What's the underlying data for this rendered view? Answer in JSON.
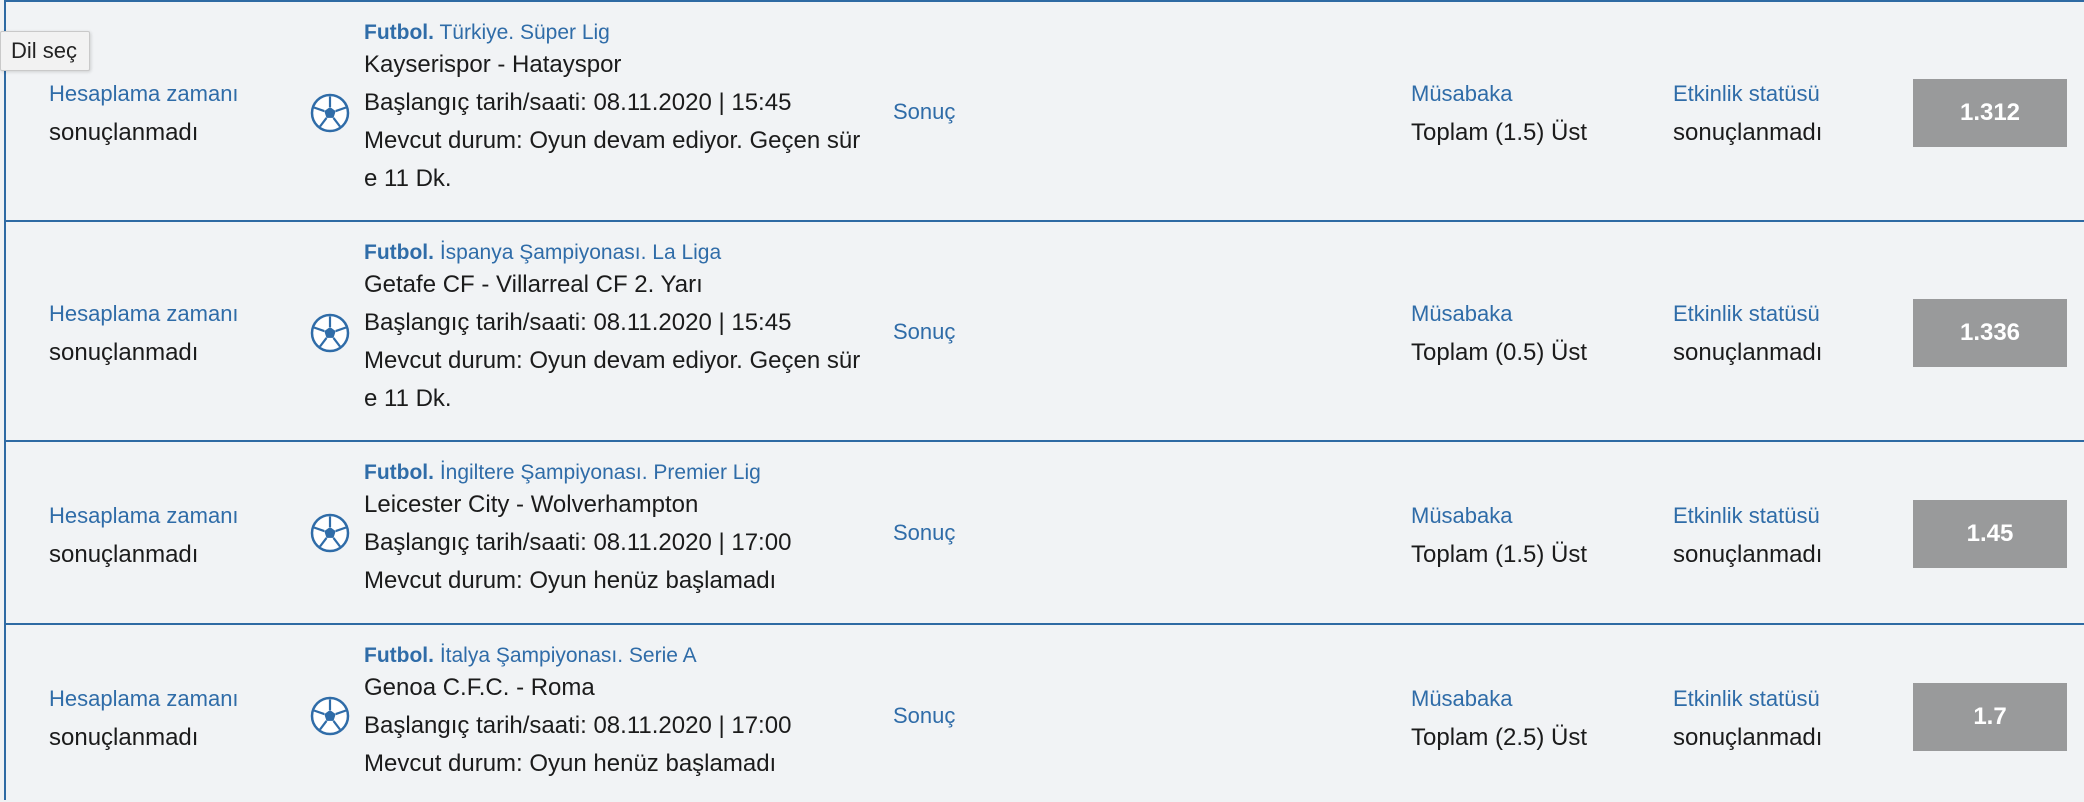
{
  "tooltip": "Dil seç",
  "rows": [
    {
      "calc_label": "Hesaplama zamanı",
      "calc_value": "sonuçlanmadı",
      "sport": "Futbol.",
      "league": " Türkiye. Süper Lig",
      "match": "Kayserispor - Hatayspor",
      "start": "Başlangıç tarih/saati: 08.11.2020 | 15:45",
      "status": "Mevcut durum: Oyun devam ediyor. Geçen süre 11 Dk.",
      "result": "Sonuç",
      "market_label": "Müsabaka",
      "market_value": "Toplam (1.5) Üst",
      "event_status_label": "Etkinlik statüsü",
      "event_status_value": "sonuçlanmadı",
      "odd": "1.312"
    },
    {
      "calc_label": "Hesaplama zamanı",
      "calc_value": "sonuçlanmadı",
      "sport": "Futbol.",
      "league": " İspanya Şampiyonası. La Liga",
      "match": "Getafe CF - Villarreal CF 2. Yarı",
      "start": "Başlangıç tarih/saati: 08.11.2020 | 15:45",
      "status": "Mevcut durum: Oyun devam ediyor. Geçen süre 11 Dk.",
      "result": "Sonuç",
      "market_label": "Müsabaka",
      "market_value": "Toplam (0.5) Üst",
      "event_status_label": "Etkinlik statüsü",
      "event_status_value": "sonuçlanmadı",
      "odd": "1.336"
    },
    {
      "calc_label": "Hesaplama zamanı",
      "calc_value": "sonuçlanmadı",
      "sport": "Futbol.",
      "league": " İngiltere Şampiyonası. Premier Lig",
      "match": "Leicester City - Wolverhampton",
      "start": "Başlangıç tarih/saati: 08.11.2020 | 17:00",
      "status": "Mevcut durum: Oyun henüz başlamadı",
      "result": "Sonuç",
      "market_label": "Müsabaka",
      "market_value": "Toplam (1.5) Üst",
      "event_status_label": "Etkinlik statüsü",
      "event_status_value": "sonuçlanmadı",
      "odd": "1.45"
    },
    {
      "calc_label": "Hesaplama zamanı",
      "calc_value": "sonuçlanmadı",
      "sport": "Futbol.",
      "league": " İtalya Şampiyonası. Serie A",
      "match": "Genoa C.F.C. - Roma",
      "start": "Başlangıç tarih/saati: 08.11.2020 | 17:00",
      "status": "Mevcut durum: Oyun henüz başlamadı",
      "result": "Sonuç",
      "market_label": "Müsabaka",
      "market_value": "Toplam (2.5) Üst",
      "event_status_label": "Etkinlik statüsü",
      "event_status_value": "sonuçlanmadı",
      "odd": "1.7"
    }
  ],
  "icons": {
    "sport": "soccer-ball-icon"
  },
  "colors": {
    "accent": "#2f6ca8",
    "divider": "#2e6aa3",
    "odd_button": "#999a9b",
    "background": "#f1f3f5"
  }
}
